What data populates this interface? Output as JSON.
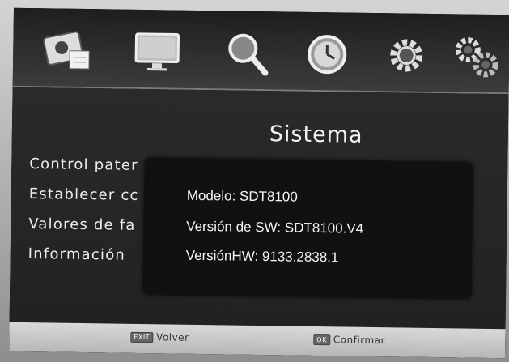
{
  "page_title": "Sistema",
  "top_menu": {
    "icons": [
      "picture-icon",
      "monitor-icon",
      "search-icon",
      "clock-icon",
      "gear-icon",
      "settings-gears-icon"
    ]
  },
  "side_menu": {
    "items": [
      {
        "label": "Control pater"
      },
      {
        "label": "Establecer cc"
      },
      {
        "label": "Valores de fa"
      },
      {
        "label": "Información"
      }
    ]
  },
  "info_panel": {
    "model": "Modelo: SDT8100",
    "sw_version": "Versión de SW: SDT8100.V4",
    "hw_version": "VersiónHW: 9133.2838.1"
  },
  "footer": {
    "exit_key": "EXIT",
    "exit_label": "Volver",
    "ok_key": "OK",
    "ok_label": "Confirmar"
  }
}
